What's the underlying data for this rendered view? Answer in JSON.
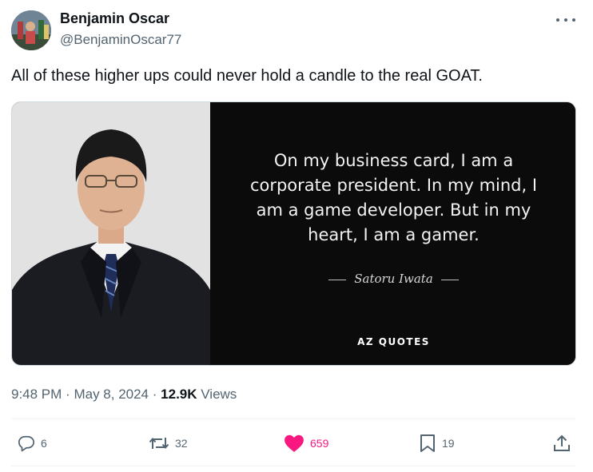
{
  "author": {
    "name": "Benjamin Oscar",
    "handle": "@BenjaminOscar77"
  },
  "tweet": {
    "text": "All of these higher ups could never hold a candle to the real GOAT."
  },
  "media": {
    "quote_lines": [
      "On my business card, I am a",
      "corporate president. In my mind, I",
      "am a game developer. But in my",
      "heart, I am a gamer."
    ],
    "quote_author": "Satoru Iwata",
    "brand": "AZ QUOTES"
  },
  "meta": {
    "time": "9:48 PM",
    "separator": "·",
    "date": "May 8, 2024",
    "views_count": "12.9K",
    "views_label": "Views"
  },
  "actions": {
    "replies": "6",
    "reposts": "32",
    "likes": "659",
    "bookmarks": "19"
  },
  "icons": [
    "more-icon",
    "reply-icon",
    "repost-icon",
    "like-icon",
    "bookmark-icon",
    "share-icon"
  ],
  "colors": {
    "text_primary": "#0f1419",
    "text_secondary": "#536471",
    "like_active": "#f91880"
  }
}
